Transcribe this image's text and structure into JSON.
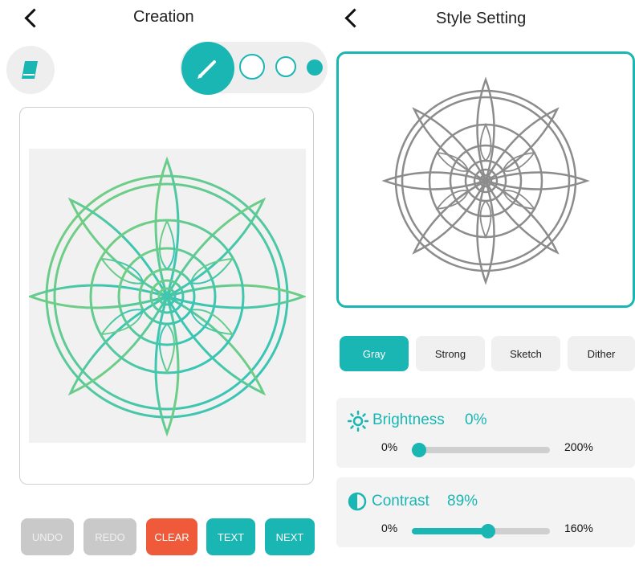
{
  "colors": {
    "accent": "#19b6b3",
    "clear": "#ef5a3a",
    "disabled": "#c9c9c9",
    "panel": "#f3f3f3"
  },
  "creation": {
    "title": "Creation",
    "tools": {
      "eraser_icon": "eraser-icon",
      "pen_icon": "pencil-icon",
      "sizes": [
        "small",
        "medium",
        "large"
      ]
    },
    "actions": {
      "undo": "UNDO",
      "redo": "REDO",
      "clear": "CLEAR",
      "text": "TEXT",
      "next": "NEXT"
    }
  },
  "style_setting": {
    "title": "Style Setting",
    "styles": [
      {
        "label": "Gray",
        "selected": true
      },
      {
        "label": "Strong",
        "selected": false
      },
      {
        "label": "Sketch",
        "selected": false
      },
      {
        "label": "Dither",
        "selected": false
      }
    ],
    "brightness": {
      "label": "Brightness",
      "value_text": "0%",
      "min": "0%",
      "max": "200%",
      "fraction": 0
    },
    "contrast": {
      "label": "Contrast",
      "value_text": "89%",
      "min": "0%",
      "max": "160%",
      "fraction": 0.56
    }
  }
}
